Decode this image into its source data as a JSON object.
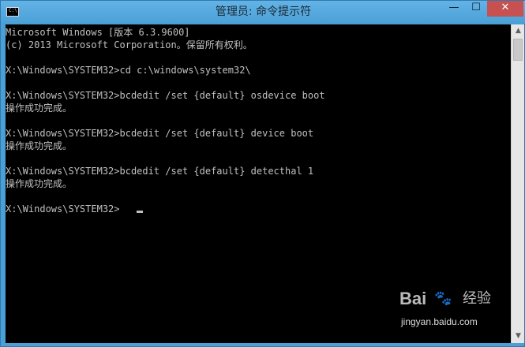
{
  "window": {
    "title": "管理员: 命令提示符",
    "controls": {
      "minimize": "—",
      "maximize": "☐",
      "close": "✕"
    },
    "icon": "cmd-icon"
  },
  "console": {
    "lines": [
      "Microsoft Windows [版本 6.3.9600]",
      "(c) 2013 Microsoft Corporation。保留所有权利。",
      "",
      "X:\\Windows\\SYSTEM32>cd c:\\windows\\system32\\",
      "",
      "X:\\Windows\\SYSTEM32>bcdedit /set {default} osdevice boot",
      "操作成功完成。",
      "",
      "X:\\Windows\\SYSTEM32>bcdedit /set {default} device boot",
      "操作成功完成。",
      "",
      "X:\\Windows\\SYSTEM32>bcdedit /set {default} detecthal 1",
      "操作成功完成。",
      "",
      "X:\\Windows\\SYSTEM32>"
    ]
  },
  "scrollbar": {
    "up_arrow": "▲",
    "down_arrow": "▼"
  },
  "watermark": {
    "brand": "Bai",
    "paw": "🐾",
    "cn": "经验",
    "url": "jingyan.baidu.com"
  }
}
